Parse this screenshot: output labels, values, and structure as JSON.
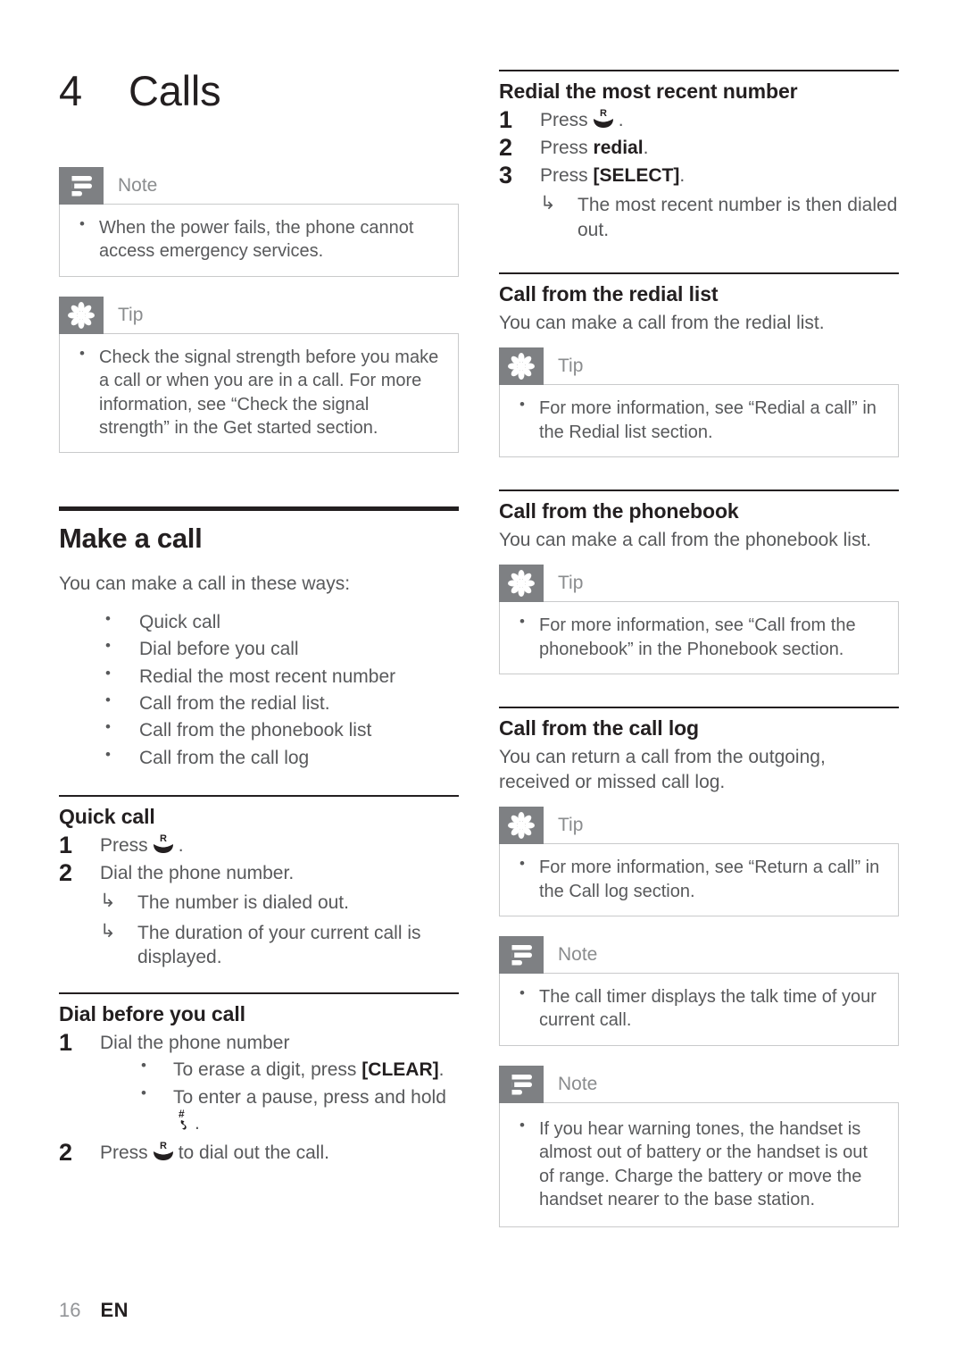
{
  "chapter": {
    "number": "4",
    "title": "Calls"
  },
  "footer": {
    "page": "16",
    "language": "EN"
  },
  "icons": {
    "talk_key": "talk-key-icon",
    "hash_key": "hash-pause-key-icon",
    "note": "note-icon",
    "tip": "tip-icon"
  },
  "left": {
    "note_top": {
      "label": "Note",
      "items": [
        "When the power fails, the phone cannot access emergency services."
      ]
    },
    "tip_top": {
      "label": "Tip",
      "items": [
        "Check the signal strength before you make a call or when you are in a call. For more information, see “Check the signal strength” in the Get started section."
      ]
    },
    "make_a_call": {
      "heading": "Make a call",
      "intro": "You can make a call in these ways:",
      "ways": [
        "Quick call",
        "Dial before you call",
        "Redial the most recent number",
        "Call from the redial list.",
        "Call from the phonebook list",
        "Call from the call log"
      ]
    },
    "quick_call": {
      "heading": "Quick call",
      "step1_num": "1",
      "step1_prefix": "Press",
      "step1_suffix": ".",
      "step2_num": "2",
      "step2_text": "Dial the phone number.",
      "result1": "The number is dialed out.",
      "result2": "The duration of your current call is displayed."
    },
    "dial_before": {
      "heading": "Dial before you call",
      "step1_num": "1",
      "step1_text": "Dial the phone number",
      "bullet1_prefix": "To erase a digit, press",
      "bullet1_key": "[CLEAR]",
      "bullet1_suffix": ".",
      "bullet2_prefix": "To enter a pause, press and hold",
      "bullet2_suffix": ".",
      "step2_num": "2",
      "step2_prefix": "Press",
      "step2_suffix": "to dial out the call."
    }
  },
  "right": {
    "redial_recent": {
      "heading": "Redial the most recent number",
      "step1_num": "1",
      "step1_prefix": "Press",
      "step1_suffix": ".",
      "step2_num": "2",
      "step2_prefix": "Press",
      "step2_key": "redial",
      "step2_suffix": ".",
      "step3_num": "3",
      "step3_prefix": "Press",
      "step3_key": "[SELECT]",
      "step3_suffix": ".",
      "result1": "The most recent number is then dialed out."
    },
    "redial_list": {
      "heading": "Call from the redial list",
      "intro": "You can make a call from the redial list.",
      "tip": {
        "label": "Tip",
        "items": [
          "For more information, see “Redial a call” in the Redial list section."
        ]
      }
    },
    "phonebook": {
      "heading": "Call from the phonebook",
      "intro": "You can make a call from the phonebook list.",
      "tip": {
        "label": "Tip",
        "items": [
          "For more information, see “Call from the phonebook” in the Phonebook section."
        ]
      }
    },
    "call_log": {
      "heading": "Call from the call log",
      "intro": "You can return a call from the outgoing, received or missed call log.",
      "tip": {
        "label": "Tip",
        "items": [
          "For more information, see “Return a call” in the Call log section."
        ]
      },
      "note1": {
        "label": "Note",
        "items": [
          "The call timer displays the talk time of your current call."
        ]
      },
      "note2": {
        "label": "Note",
        "items": [
          "If you hear warning tones, the handset is almost out of battery or the handset is out of range. Charge the battery or move the handset nearer to the base station."
        ]
      }
    }
  },
  "colors": {
    "heading": "#231f20",
    "body": "#58595b",
    "callout_icon_bg": "#7e8083",
    "callout_border": "#c9cacb",
    "callout_label": "#8a8c8e"
  }
}
